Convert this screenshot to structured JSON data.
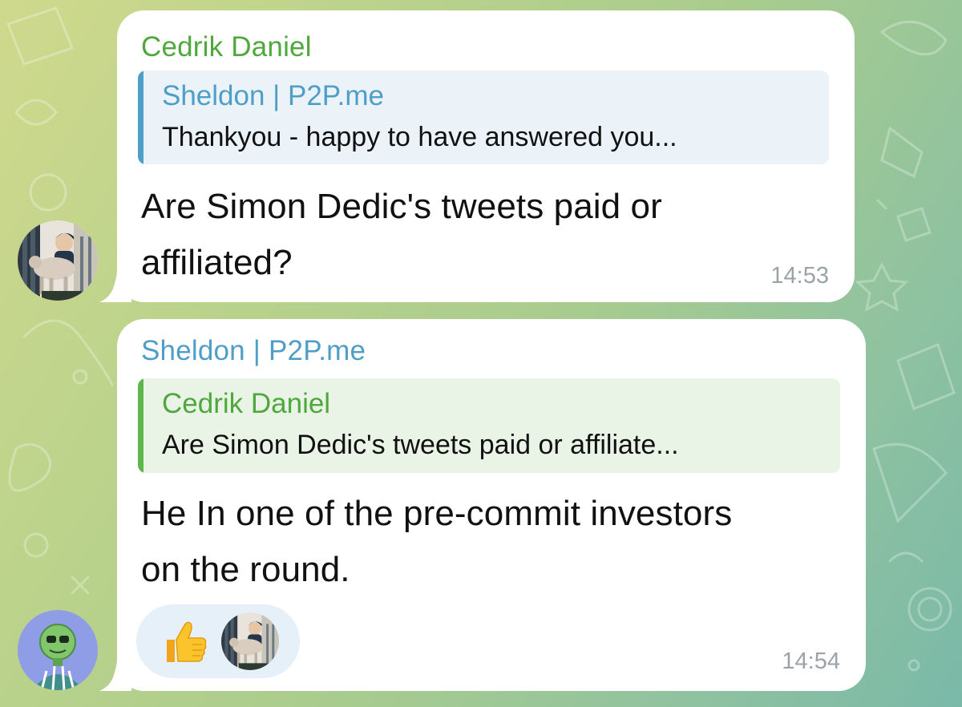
{
  "colors": {
    "bubble_bg": "#ffffff",
    "accent_green": "#4fa83d",
    "accent_blue": "#4f9ec7",
    "timestamp": "#9aa3a8",
    "reaction_bg": "#e6f0f8"
  },
  "messages": [
    {
      "sender": "Cedrik Daniel",
      "avatar_icon": "user-avatar-man-with-goat",
      "reply": {
        "name": "Sheldon | P2P.me",
        "text": "Thankyou - happy to have answered you..."
      },
      "lines": [
        "Are Simon Dedic's tweets paid or",
        "affiliated?"
      ],
      "time": "14:53"
    },
    {
      "sender": "Sheldon | P2P.me",
      "avatar_icon": "user-avatar-green-robot",
      "reply": {
        "name": "Cedrik Daniel",
        "text": "Are Simon Dedic's tweets paid or affiliate..."
      },
      "lines": [
        "He In one of the pre-commit investors",
        "on the round."
      ],
      "reaction": {
        "emoji_icon": "thumbs-up-icon",
        "reactor_avatar_icon": "user-avatar-man-with-goat"
      },
      "time": "14:54"
    }
  ]
}
